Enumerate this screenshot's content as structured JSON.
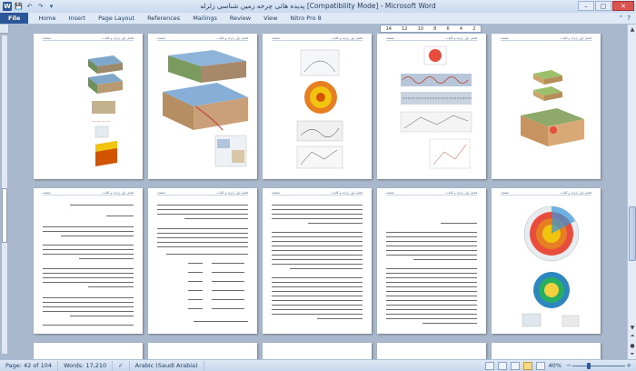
{
  "window": {
    "title": "پدیده هائی چرخه زمین شناسی زلزله [Compatibility Mode] - Microsoft Word",
    "app_icon": "W",
    "controls": {
      "minimize": "–",
      "maximize": "□",
      "close": "✕"
    }
  },
  "qat": {
    "save_icon": "💾",
    "undo_icon": "↶",
    "redo_icon": "↷",
    "customize_icon": "▾"
  },
  "ribbon": {
    "tabs": [
      {
        "label": "File"
      },
      {
        "label": "Home"
      },
      {
        "label": "Insert"
      },
      {
        "label": "Page Layout"
      },
      {
        "label": "References"
      },
      {
        "label": "Mailings"
      },
      {
        "label": "Review"
      },
      {
        "label": "View"
      },
      {
        "label": "Nitro Pro 8"
      }
    ],
    "minimize_ribbon_icon": "⌃",
    "help_icon": "?"
  },
  "ruler": {
    "ticks": [
      "14",
      "12",
      "10",
      "8",
      "6",
      "4",
      "2"
    ]
  },
  "pages": {
    "header_text": "فصل اول زلزله و کلیات",
    "header_page_label": "صفحه"
  },
  "status": {
    "page": "Page: 42 of 104",
    "words": "Words: 17,210",
    "language": "Arabic (Saudi Arabia)",
    "zoom": "40%",
    "zoom_fraction": 0.3,
    "minus": "−",
    "plus": "+"
  },
  "colors": {
    "file_tab": "#2b579a",
    "workspace": "#a9b8cc",
    "close_button": "#d9534f"
  }
}
